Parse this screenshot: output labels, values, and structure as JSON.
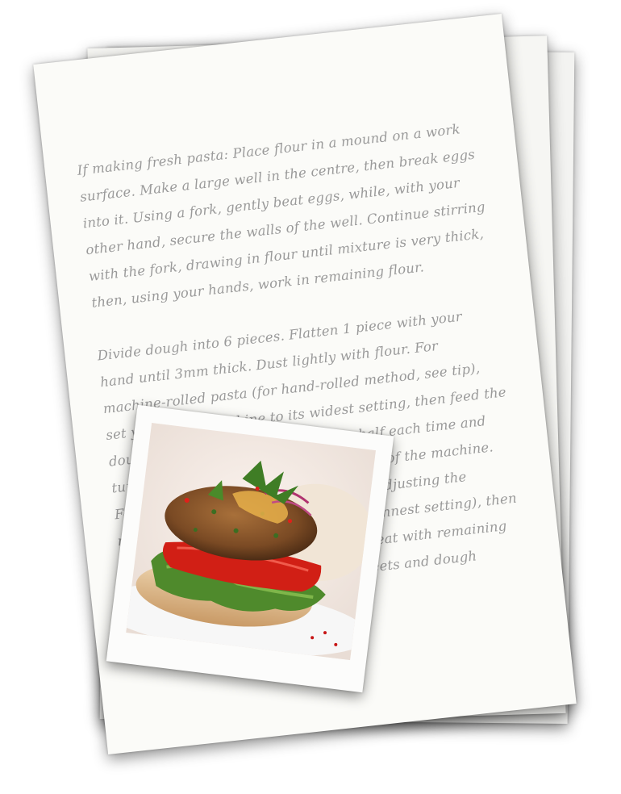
{
  "recipe": {
    "paragraphs": [
      "If making fresh pasta: Place flour in a mound on a work surface. Make a large well in the centre, then break eggs into it. Using a fork, gently beat eggs, while, with your other hand, secure the walls of the well. Continue stirring with the fork, drawing in flour until mixture is very thick, then, using your hands, work in remaining flour.",
      "Divide dough into 6 pieces. Flatten 1 piece with your hand until 3mm thick. Dust lightly with flour. For machine-rolled pasta (for hand-rolled method, see tip), set your pasta machine to its widest setting, then feed the dough through 5 times, folding it in half each time and turning until it is smooth and the width of the machine. Feed dough through, without folding, adjusting the machine 1 notch at a time until the thinnest setting), then place pasta on a floured surface. Repeat with remaining dough until you have rolled out 2 sheets and dough remains pliable"
    ]
  },
  "photo": {
    "icon": "burger-photo"
  }
}
